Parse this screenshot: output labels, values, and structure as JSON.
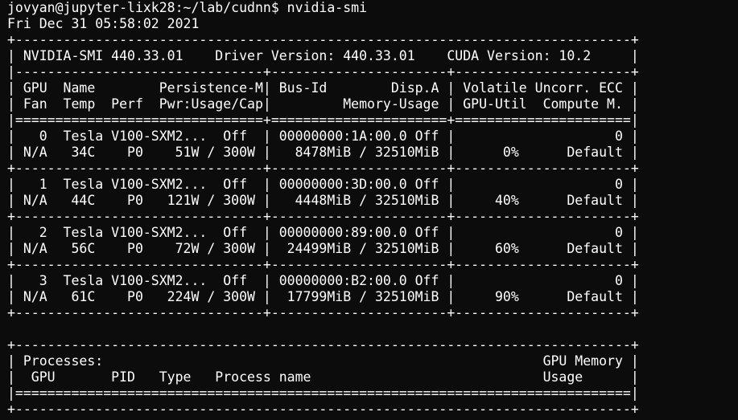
{
  "terminal": {
    "lines": [
      "jovyan@jupyter-lixk28:~/lab/cudnn$ nvidia-smi",
      "Fri Dec 31 05:58:02 2021",
      "+-----------------------------------------------------------------------------+",
      "| NVIDIA-SMI 440.33.01    Driver Version: 440.33.01    CUDA Version: 10.2     |",
      "|-------------------------------+----------------------+----------------------+",
      "| GPU  Name        Persistence-M| Bus-Id        Disp.A | Volatile Uncorr. ECC |",
      "| Fan  Temp  Perf  Pwr:Usage/Cap|         Memory-Usage | GPU-Util  Compute M. |",
      "|===============================+======================+======================|",
      "|   0  Tesla V100-SXM2...  Off  | 00000000:1A:00.0 Off |                    0 |",
      "| N/A   34C    P0    51W / 300W |   8478MiB / 32510MiB |      0%      Default |",
      "+-------------------------------+----------------------+----------------------+",
      "|   1  Tesla V100-SXM2...  Off  | 00000000:3D:00.0 Off |                    0 |",
      "| N/A   44C    P0   121W / 300W |   4448MiB / 32510MiB |     40%      Default |",
      "+-------------------------------+----------------------+----------------------+",
      "|   2  Tesla V100-SXM2...  Off  | 00000000:89:00.0 Off |                    0 |",
      "| N/A   56C    P0    72W / 300W |  24499MiB / 32510MiB |     60%      Default |",
      "+-------------------------------+----------------------+----------------------+",
      "|   3  Tesla V100-SXM2...  Off  | 00000000:B2:00.0 Off |                    0 |",
      "| N/A   61C    P0   224W / 300W |  17799MiB / 32510MiB |     90%      Default |",
      "+-------------------------------+----------------------+----------------------+",
      "",
      "+-----------------------------------------------------------------------------+",
      "| Processes:                                                       GPU Memory |",
      "|  GPU       PID   Type   Process name                             Usage      |",
      "|=============================================================================|",
      "+-----------------------------------------------------------------------------+"
    ]
  }
}
